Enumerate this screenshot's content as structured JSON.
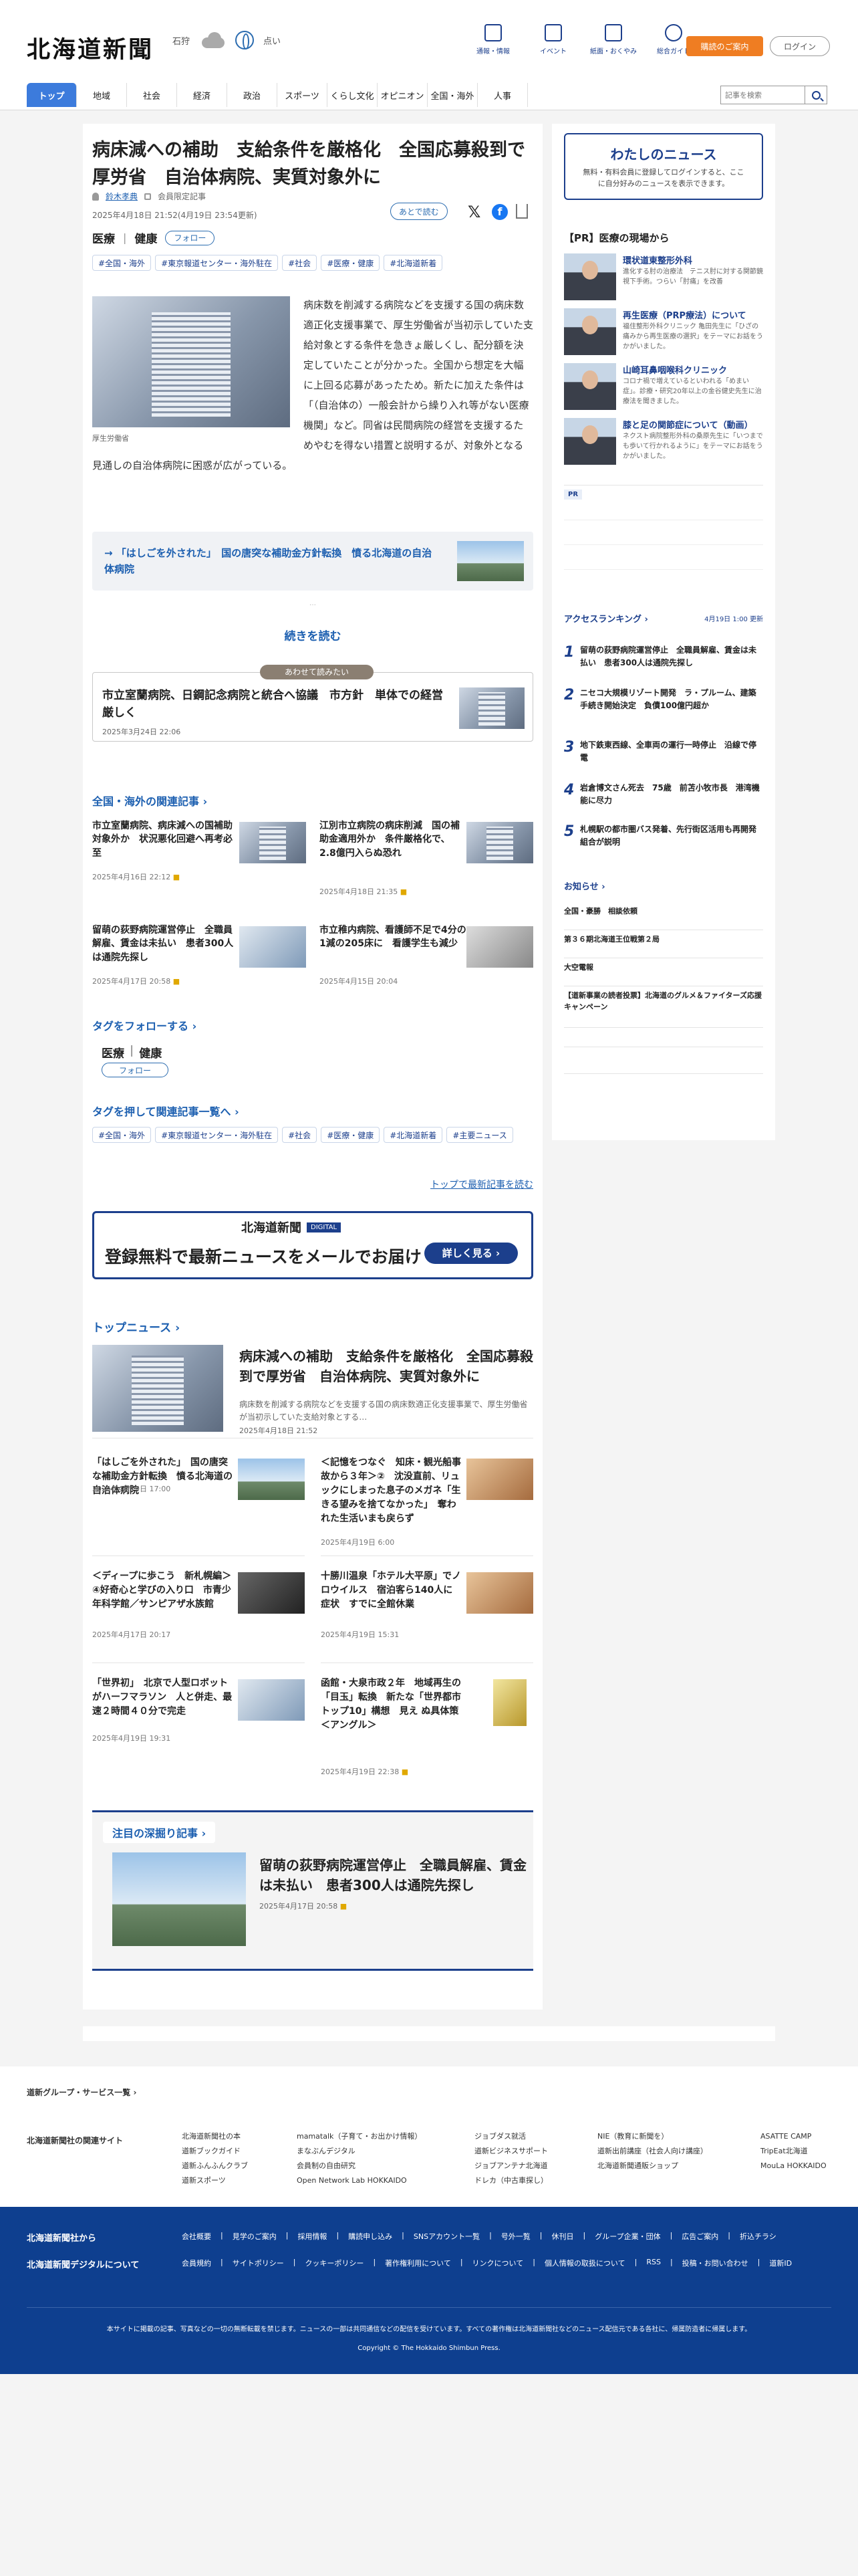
{
  "header": {
    "logo": "北海道新聞",
    "weather": {
      "location": "石狩",
      "icon": "cloud-icon",
      "region_label": "点い"
    },
    "tools": [
      {
        "label": "通報・情報"
      },
      {
        "label": "イベント"
      },
      {
        "label": "紙面・おくやみ"
      },
      {
        "label": "総合ガイド"
      }
    ],
    "subscribe_label": "購読のご案内",
    "login_label": "ログイン",
    "search_placeholder": "記事を検索"
  },
  "nav": [
    "トップ",
    "地域",
    "社会",
    "経済",
    "政治",
    "スポーツ",
    "くらし文化",
    "オピニオン",
    "全国・海外",
    "人事"
  ],
  "article": {
    "title": "病床減への補助　支給条件を厳格化　全国応募殺到で厚労省　自治体病院、実質対象外に",
    "author": "鈴木孝典",
    "author_note": "会員限定記事",
    "date": "2025年4月18日 21:52(4月19日 23:54更新)",
    "later_label": "あとで読む",
    "tag_names": [
      "医療",
      "健康"
    ],
    "follow_label": "フォロー",
    "chips": [
      "#全国・海外",
      "#東京報道センター・海外駐在",
      "#社会",
      "#医療・健康",
      "#北海道新着"
    ],
    "photo_caption": "厚生労働省",
    "body": "病床数を削減する病院などを支援する国の病床数適正化支援事業で、厚生労働省が当初示していた支給対象とする条件を急きょ厳しくし、配分額を決定していたことが分かった。全国から想定を大幅に上回る応募があったため。新たに加えた条件は「（自治体の）一般会計から繰り入れ等がない医療機関」など。同省は民間病院の経営を支援するためやむを得ない措置と説明するが、対象外となる見通しの自治体病院に困惑が広がっている。",
    "link_box": "「はしごを外された」　国の唐突な補助金方針転換　憤る北海道の自治体病院",
    "read_more": "続きを読む",
    "related_label": "あわせて読みたい",
    "related_title": "市立室蘭病院、日鋼記念病院と統合へ協議　市方針　単体での経営厳しく",
    "related_date": "2025年3月24日 22:06"
  },
  "national": {
    "title": "全国・海外の関連記事",
    "items": [
      {
        "title": "市立室蘭病院、病床減への国補助対象外か　状況悪化回避へ再考必至",
        "date": "2025年4月16日 22:12"
      },
      {
        "title": "江別市立病院の病床削減　国の補助金適用外か　条件厳格化で、2.8億円入らぬ恐れ",
        "date": "2025年4月18日 21:35"
      },
      {
        "title": "留萌の荻野病院運営停止　全職員解雇、賃金は未払い　患者300人は通院先探し",
        "date": "2025年4月17日 20:58"
      },
      {
        "title": "市立稚内病院、看護師不足で4分の1減の205床に　看護学生も減少",
        "date": "2025年4月15日 20:04"
      }
    ]
  },
  "follow": {
    "title": "タグをフォローする",
    "tags": [
      "医療",
      "健康"
    ],
    "button": "フォロー"
  },
  "taglist": {
    "title": "タグを押して関連記事一覧へ",
    "chips": [
      "#全国・海外",
      "#東京報道センター・海外駐在",
      "#社会",
      "#医療・健康",
      "#北海道新着",
      "#主要ニュース"
    ]
  },
  "top_read_link": "トップで最新記事を読む",
  "banner": {
    "logo": "北海道新聞",
    "badge": "DIGITAL",
    "text": "登録無料で最新ニュースをメールでお届け",
    "button": "詳しく見る"
  },
  "topnews": {
    "title": "トップニュース",
    "lead": {
      "title": "病床減への補助　支給条件を厳格化　全国応募殺到で厚労省　自治体病院、実質対象外に",
      "summary": "病床数を削減する病院などを支援する国の病床数適正化支援事業で、厚生労働省が当初示していた支給対象とする…",
      "date": "2025年4月18日 21:52"
    },
    "items": [
      {
        "title": "「はしごを外された」　国の唐突な補助金方針転換　憤る北海道の自治体病院",
        "date": "2025年4月19日 17:00"
      },
      {
        "title": "＜記憶をつなぐ　知床・観光船事故から３年＞②　沈没直前、リュックにしまった息子のメガネ「生きる望みを捨てなかった」　奪われた生活いまも戻らず",
        "date": "2025年4月19日 6:00"
      },
      {
        "title": "＜ディープに歩こう　新札幌編＞④好奇心と学びの入り口　市青少年科学館／サンピアザ水族館",
        "date": "2025年4月17日 20:17"
      },
      {
        "title": "十勝川温泉「ホテル大平原」でノロウイルス　宿泊客ら140人に症状　すでに全館休業",
        "date": "2025年4月19日 15:31"
      },
      {
        "title": "「世界初」　北京で人型ロボットがハーフマラソン　人と併走、最速２時間４０分で完走",
        "date": "2025年4月19日 19:31"
      },
      {
        "title": "函館・大泉市政２年　地域再生の「目玉」転換　新たな「世界都市トップ10」構想　見え ぬ具体策＜アングル＞",
        "date": "2025年4月19日 22:38"
      }
    ]
  },
  "deep": {
    "title": "注目の深掘り記事",
    "item_title": "留萌の荻野病院運営停止　全職員解雇、賃金は未払い　患者300人は通院先探し",
    "item_date": "2025年4月17日 20:58"
  },
  "sidebar": {
    "mynews_title": "わたしのニュース",
    "mynews_text": "無料・有料会員に登録してログインすると、ここに自分好みのニュースを表示できます。",
    "pr_title": "【PR】医療の現場から",
    "pr_items": [
      {
        "name": "環状道東整形外科",
        "text": "進化する肘の治療法　テニス肘に対する関節鏡視下手術。つらい「肘痛」を改善"
      },
      {
        "name": "再生医療（PRP療法）について",
        "text": "福住整形外科クリニック 亀田先生に「ひざの痛みから再生医療の選択」をテーマにお話をうかがいました。"
      },
      {
        "name": "山崎耳鼻咽喉科クリニック",
        "text": "コロナ禍で増えているといわれる「めまい症」。診療・研究20年以上の金谷健史先生に治療法を聞きました。"
      },
      {
        "name": "膝と足の関節症について（動画）",
        "text": "ネクスト病院整形外科の桑原先生に「いつまでも歩いて行かれるように」をテーマにお話をうかがいました。"
      }
    ],
    "pr_badge": "PR",
    "ranking_title": "アクセスランキング",
    "ranking_time": "4月19日 1:00 更新",
    "ranking": [
      {
        "n": "1",
        "title": "留萌の荻野病院運営停止　全職員解雇、賃金は未払い　患者300人は通院先探し"
      },
      {
        "n": "2",
        "title": "ニセコ大規模リゾート開発　ラ・プルーム、建築手続き開始決定　負債100億円超か"
      },
      {
        "n": "3",
        "title": "地下鉄東西線、全車両の運行一時停止　沿線で停電"
      },
      {
        "n": "4",
        "title": "岩倉博文さん死去　75歳　前苫小牧市長　港湾機能に尽力"
      },
      {
        "n": "5",
        "title": "札幌駅の都市圏バス発着、先行街区活用も再開発組合が説明"
      }
    ],
    "notice_title": "お知らせ",
    "notices": [
      "全国・豪勝　相談依頼",
      "第３６期北海道王位戦第２局",
      "大空電報",
      "【道新事業の読者投票】北海道のグルメ＆ファイターズ応援キャンペーン"
    ]
  },
  "footer": {
    "group_link": "道新グループ・サービス一覧",
    "sites_label": "北海道新聞社の関連サイト",
    "sites": [
      [
        "北海道新聞社の本",
        "道新ブックガイド",
        "道新ふんふんクラブ",
        "道新スポーツ"
      ],
      [
        "mamatalk（子育て・お出かけ情報）",
        "まなぶんデジタル",
        "会員制の自由研究",
        "Open Network Lab HOKKAIDO"
      ],
      [
        "ジョブダス就活",
        "道新ビジネスサポート",
        "ジョブアンテナ北海道",
        "ドレカ（中古車探し）"
      ],
      [
        "NIE（教育に新聞を）",
        "道新出前講座（社会人向け講座）",
        "北海道新聞通販ショップ"
      ],
      [
        "ASATTE CAMP",
        "TripEat北海道",
        "MouLa HOKKAIDO"
      ]
    ],
    "company_label": "北海道新聞社から",
    "company_links": [
      "会社概要",
      "見学のご案内",
      "採用情報",
      "購読申し込み",
      "SNSアカウント一覧",
      "号外一覧",
      "休刊日",
      "グループ企業・団体",
      "広告ご案内",
      "折込チラシ"
    ],
    "digital_label": "北海道新聞デジタルについて",
    "digital_links": [
      "会員規約",
      "サイトポリシー",
      "クッキーポリシー",
      "著作権利用について",
      "リンクについて",
      "個人情報の取扱について",
      "RSS",
      "投稿・お問い合わせ",
      "道新ID"
    ],
    "notice": "本サイトに掲載の記事、写真などの一切の無断転載を禁じます。ニュースの一部は共同通信などの配信を受けています。すべての著作権は北海道新聞社などのニュース配信元である各社に、帰属防造者に帰属します。",
    "copyright": "Copyright © The Hokkaido Shimbun Press."
  }
}
